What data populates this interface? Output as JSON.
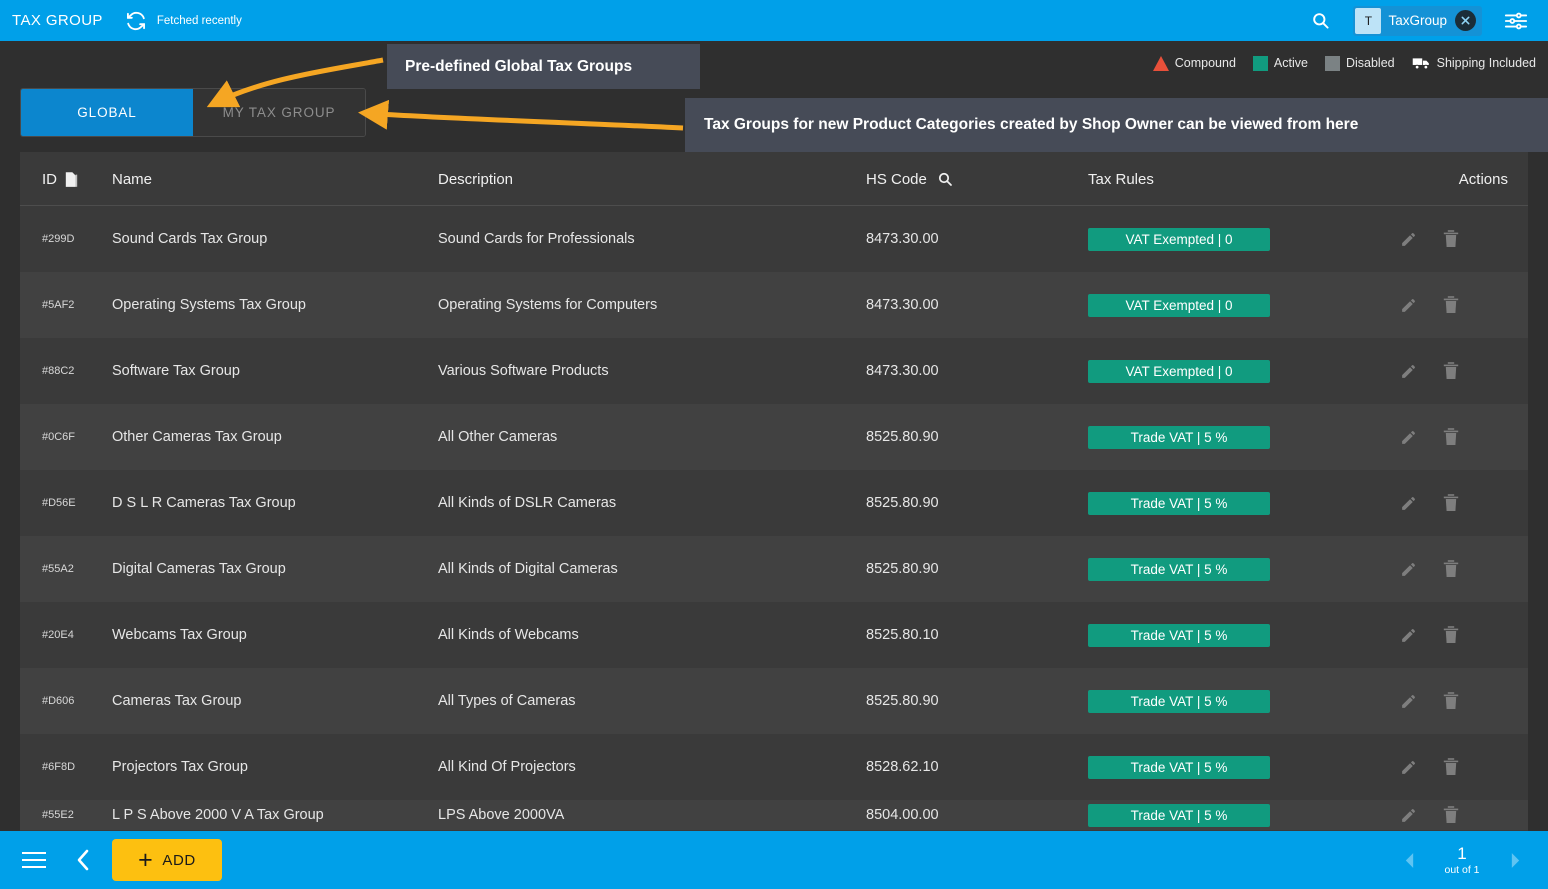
{
  "header": {
    "title": "TAX GROUP",
    "refresh_icon": "refresh-icon",
    "fetch_status": "Fetched recently",
    "search_icon": "search-icon",
    "chip": {
      "avatar_letter": "T",
      "label": "TaxGroup",
      "close_icon": "close-icon"
    },
    "filter_icon": "filter-settings-icon"
  },
  "legend": [
    {
      "label": "Compound",
      "swatch": "triangle",
      "color": "#e8503a"
    },
    {
      "label": "Active",
      "swatch": "square",
      "color": "#119b7f"
    },
    {
      "label": "Disabled",
      "swatch": "square",
      "color": "#7b8284"
    },
    {
      "label": "Shipping Included",
      "swatch": "truck-icon",
      "color": "#ffffff"
    }
  ],
  "tabs": [
    {
      "label": "GLOBAL",
      "active": true
    },
    {
      "label": "MY TAX GROUP",
      "active": false
    }
  ],
  "callouts": [
    {
      "text": "Pre-defined Global Tax Groups"
    },
    {
      "text": "Tax Groups for new Product Categories created by Shop Owner can be viewed from here"
    }
  ],
  "table": {
    "columns": {
      "id": "ID",
      "id_icon": "copy-icon",
      "name": "Name",
      "description": "Description",
      "hs_code": "HS Code",
      "hs_code_icon": "search-icon",
      "tax_rules": "Tax Rules",
      "actions": "Actions"
    },
    "row_status_color": "#4caf50",
    "rows": [
      {
        "id": "#299D",
        "name": "Sound Cards Tax Group",
        "description": "Sound Cards for Professionals",
        "hs_code": "8473.30.00",
        "rule": "VAT Exempted | 0"
      },
      {
        "id": "#5AF2",
        "name": "Operating Systems Tax Group",
        "description": "Operating Systems for Computers",
        "hs_code": "8473.30.00",
        "rule": "VAT Exempted | 0"
      },
      {
        "id": "#88C2",
        "name": "Software Tax Group",
        "description": "Various Software Products",
        "hs_code": "8473.30.00",
        "rule": "VAT Exempted | 0"
      },
      {
        "id": "#0C6F",
        "name": "Other Cameras Tax Group",
        "description": "All Other Cameras",
        "hs_code": "8525.80.90",
        "rule": "Trade VAT | 5 %"
      },
      {
        "id": "#D56E",
        "name": "D S L R Cameras Tax Group",
        "description": "All Kinds of DSLR Cameras",
        "hs_code": "8525.80.90",
        "rule": "Trade VAT | 5 %"
      },
      {
        "id": "#55A2",
        "name": "Digital Cameras Tax Group",
        "description": "All Kinds of Digital Cameras",
        "hs_code": "8525.80.90",
        "rule": "Trade VAT | 5 %"
      },
      {
        "id": "#20E4",
        "name": "Webcams Tax Group",
        "description": "All Kinds of Webcams",
        "hs_code": "8525.80.10",
        "rule": "Trade VAT | 5 %"
      },
      {
        "id": "#D606",
        "name": "Cameras Tax Group",
        "description": "All Types of Cameras",
        "hs_code": "8525.80.90",
        "rule": "Trade VAT | 5 %"
      },
      {
        "id": "#6F8D",
        "name": "Projectors Tax Group",
        "description": "All Kind Of Projectors",
        "hs_code": "8528.62.10",
        "rule": "Trade VAT | 5 %"
      },
      {
        "id": "#55E2",
        "name": "L P S Above 2000 V A Tax Group",
        "description": "LPS Above 2000VA",
        "hs_code": "8504.00.00",
        "rule": "Trade VAT | 5 %"
      }
    ],
    "actions": {
      "edit_icon": "pencil-icon",
      "delete_icon": "trash-icon"
    }
  },
  "bottombar": {
    "menu_icon": "hamburger-menu-icon",
    "back_icon": "chevron-left-icon",
    "add_label": "ADD",
    "add_plus": "+",
    "pagination": {
      "prev_icon": "chevron-left-icon",
      "next_icon": "chevron-right-icon",
      "current": "1",
      "total_text": "out of 1"
    }
  },
  "colors": {
    "accent_blue": "#00a0e9",
    "tab_active": "#0c86ce",
    "badge_green": "#119b7f",
    "add_yellow": "#fdc010",
    "annotation_orange": "#f5a623",
    "callout_bg": "#464b57"
  }
}
